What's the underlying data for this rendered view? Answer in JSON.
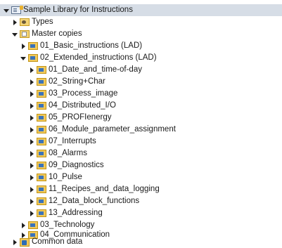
{
  "tree": {
    "items": [
      {
        "label": "Sample Library for Instructions",
        "level": 0,
        "state": "expanded",
        "icon": "library-icon",
        "selected": true
      },
      {
        "label": "Types",
        "level": 1,
        "state": "collapsed",
        "icon": "types-folder-icon"
      },
      {
        "label": "Master copies",
        "level": 1,
        "state": "expanded",
        "icon": "master-copies-folder-icon"
      },
      {
        "label": "01_Basic_instructions (LAD)",
        "level": 2,
        "state": "collapsed",
        "icon": "folder-icon"
      },
      {
        "label": "02_Extended_instructions (LAD)",
        "level": 2,
        "state": "expanded",
        "icon": "folder-icon"
      },
      {
        "label": "01_Date_and_time-of-day",
        "level": 3,
        "state": "collapsed",
        "icon": "folder-icon"
      },
      {
        "label": "02_String+Char",
        "level": 3,
        "state": "collapsed",
        "icon": "folder-icon"
      },
      {
        "label": "03_Process_image",
        "level": 3,
        "state": "collapsed",
        "icon": "folder-icon"
      },
      {
        "label": "04_Distributed_I/O",
        "level": 3,
        "state": "collapsed",
        "icon": "folder-icon"
      },
      {
        "label": "05_PROFIenergy",
        "level": 3,
        "state": "collapsed",
        "icon": "folder-icon"
      },
      {
        "label": "06_Module_parameter_assignment",
        "level": 3,
        "state": "collapsed",
        "icon": "folder-icon"
      },
      {
        "label": "07_Interrupts",
        "level": 3,
        "state": "collapsed",
        "icon": "folder-icon"
      },
      {
        "label": "08_Alarms",
        "level": 3,
        "state": "collapsed",
        "icon": "folder-icon"
      },
      {
        "label": "09_Diagnostics",
        "level": 3,
        "state": "collapsed",
        "icon": "folder-icon"
      },
      {
        "label": "10_Pulse",
        "level": 3,
        "state": "collapsed",
        "icon": "folder-icon"
      },
      {
        "label": "11_Recipes_and_data_logging",
        "level": 3,
        "state": "collapsed",
        "icon": "folder-icon"
      },
      {
        "label": "12_Data_block_functions",
        "level": 3,
        "state": "collapsed",
        "icon": "folder-icon"
      },
      {
        "label": "13_Addressing",
        "level": 3,
        "state": "collapsed",
        "icon": "folder-icon"
      },
      {
        "label": "03_Technology",
        "level": 2,
        "state": "collapsed",
        "icon": "folder-icon"
      },
      {
        "label": "04_Communication",
        "level": 2,
        "state": "collapsed",
        "icon": "folder-icon"
      },
      {
        "label": "Common data",
        "level": 1,
        "state": "collapsed",
        "icon": "common-data-icon"
      }
    ]
  }
}
